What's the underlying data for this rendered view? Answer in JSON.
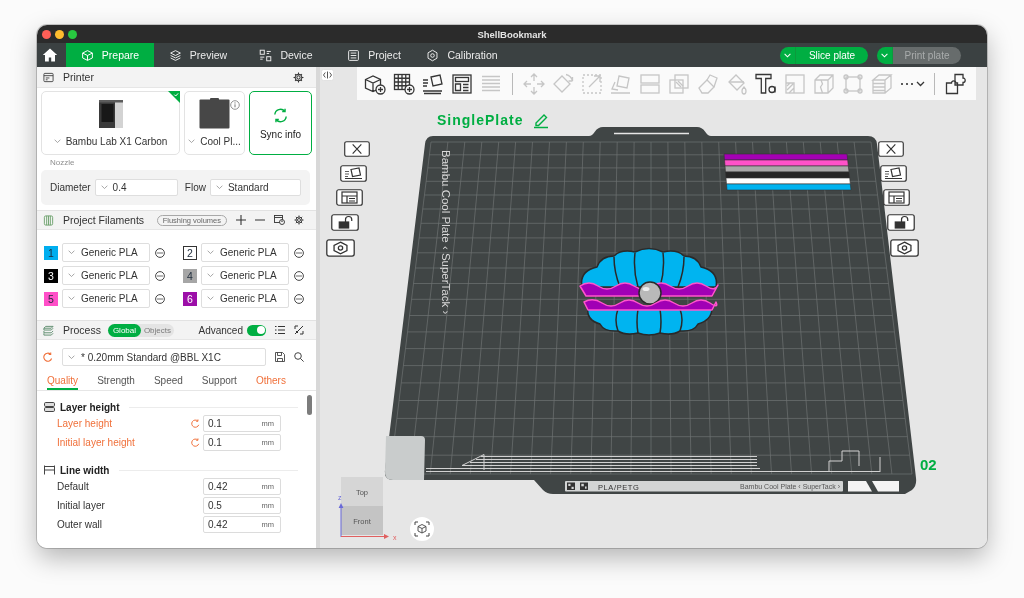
{
  "window": {
    "title": "ShellBookmark"
  },
  "top_tabs": [
    {
      "label": "Prepare",
      "selected": true
    },
    {
      "label": "Preview",
      "selected": false
    },
    {
      "label": "Device",
      "selected": false
    },
    {
      "label": "Project",
      "selected": false
    },
    {
      "label": "Calibration",
      "selected": false
    }
  ],
  "actions": [
    {
      "label": "Slice plate",
      "disabled": false
    },
    {
      "label": "Print plate",
      "disabled": true
    }
  ],
  "printer": {
    "title": "Printer",
    "printer_name": "Bambu Lab X1 Carbon",
    "printer_selected": true,
    "plate_name": "Cool Pl...",
    "sync_label": "Sync info",
    "nozzle_label": "Nozzle",
    "diameter_label": "Diameter",
    "diameter": "0.4",
    "flow_label": "Flow",
    "flow": "Standard"
  },
  "filaments": {
    "title": "Project Filaments",
    "flushing_label": "Flushing volumes",
    "items": [
      {
        "number": "1",
        "color": "#00aeef",
        "name": "Generic PLA"
      },
      {
        "number": "2",
        "color": "#ffffff",
        "name": "Generic PLA"
      },
      {
        "number": "3",
        "color": "#000000",
        "name": "Generic PLA"
      },
      {
        "number": "4",
        "color": "#a6a6a6",
        "name": "Generic PLA"
      },
      {
        "number": "5",
        "color": "#ff4fc8",
        "name": "Generic PLA"
      },
      {
        "number": "6",
        "color": "#9c0fa8",
        "name": "Generic PLA"
      }
    ]
  },
  "process": {
    "title": "Process",
    "scopes": [
      {
        "label": "Global",
        "selected": true
      },
      {
        "label": "Objects",
        "selected": false
      }
    ],
    "advanced_label": "Advanced",
    "advanced": true,
    "preset": "* 0.20mm Standard @BBL X1C",
    "preset_modified": true,
    "tabs": [
      {
        "label": "Quality",
        "selected": true,
        "modified": true
      },
      {
        "label": "Strength",
        "selected": false,
        "modified": false
      },
      {
        "label": "Speed",
        "selected": false,
        "modified": false
      },
      {
        "label": "Support",
        "selected": false,
        "modified": false
      },
      {
        "label": "Others",
        "selected": false,
        "modified": true
      }
    ],
    "groups": [
      {
        "title": "Layer height",
        "params": [
          {
            "label": "Layer height",
            "value": "0.1",
            "unit": "mm",
            "modified": true
          },
          {
            "label": "Initial layer height",
            "value": "0.1",
            "unit": "mm",
            "modified": true
          }
        ]
      },
      {
        "title": "Line width",
        "params": [
          {
            "label": "Default",
            "value": "0.42",
            "unit": "mm",
            "modified": false
          },
          {
            "label": "Initial layer",
            "value": "0.5",
            "unit": "mm",
            "modified": false
          },
          {
            "label": "Outer wall",
            "value": "0.42",
            "unit": "mm",
            "modified": false
          }
        ]
      }
    ]
  },
  "toolbar": [
    {
      "disabled": false
    },
    {
      "disabled": false
    },
    {
      "disabled": false
    },
    {
      "disabled": false
    },
    {
      "disabled": true
    },
    {
      "disabled": true
    },
    {
      "disabled": true
    },
    {
      "disabled": true
    },
    {
      "disabled": true
    },
    {
      "disabled": true
    },
    {
      "disabled": true
    },
    {
      "disabled": true
    },
    {
      "disabled": true
    },
    {
      "disabled": false
    },
    {
      "disabled": true
    },
    {
      "disabled": true
    },
    {
      "disabled": true
    },
    {
      "disabled": true
    },
    {
      "disabled": false
    },
    {
      "disabled": false
    }
  ],
  "plate": {
    "name": "SinglePlate",
    "bed_label": "Bambu Cool Plate ‹ SuperTack ›",
    "number": "02",
    "footer_material": "PLA/PETG",
    "footer_plate": "Bambu Cool Plate ‹ SuperTack ›"
  },
  "view_cube": {
    "top": "Top",
    "front": "Front",
    "x_axis": "x",
    "z_axis": "z"
  }
}
